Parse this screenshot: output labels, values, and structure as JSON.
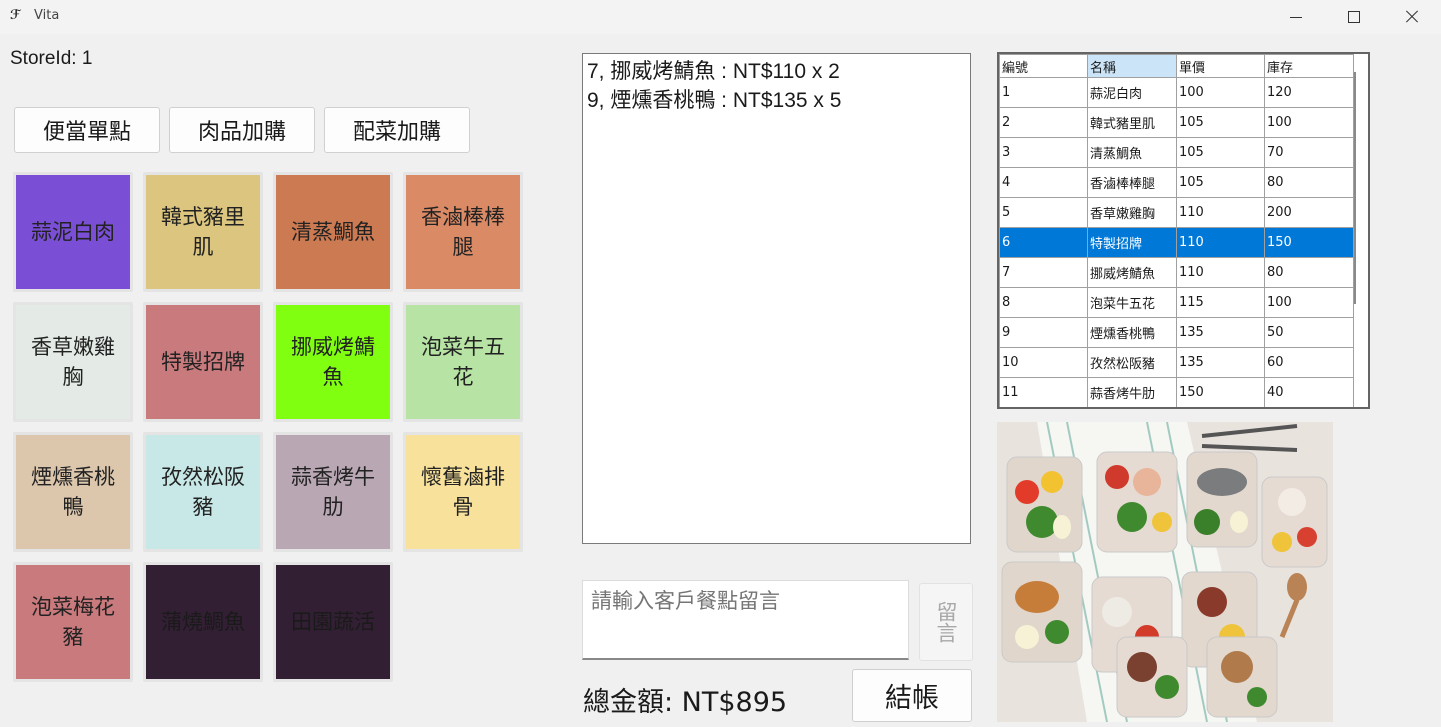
{
  "window": {
    "title": "Vita",
    "icon": "app-logo-icon"
  },
  "store": {
    "label": "StoreId: 1"
  },
  "categories": [
    {
      "label": "便當單點"
    },
    {
      "label": "肉品加購"
    },
    {
      "label": "配菜加購"
    }
  ],
  "menu_items": [
    {
      "name": "蒜泥白肉",
      "color": "#7a4fd6"
    },
    {
      "name": "韓式豬里肌",
      "color": "#dcc67f"
    },
    {
      "name": "清蒸鯛魚",
      "color": "#cc7a52"
    },
    {
      "name": "香滷棒棒腿",
      "color": "#db8a66"
    },
    {
      "name": "香草嫩雞胸",
      "color": "#e4ebe6"
    },
    {
      "name": "特製招牌",
      "color": "#c97a7d"
    },
    {
      "name": "挪威烤鯖魚",
      "color": "#80ff10"
    },
    {
      "name": "泡菜牛五花",
      "color": "#b7e3a4"
    },
    {
      "name": "煙燻香桃鴨",
      "color": "#dcc7ad"
    },
    {
      "name": "孜然松阪豬",
      "color": "#c7e8e7"
    },
    {
      "name": "蒜香烤牛肋",
      "color": "#b9a7b4"
    },
    {
      "name": "懷舊滷排骨",
      "color": "#f7e19b"
    },
    {
      "name": "泡菜梅花豬",
      "color": "#c97a7d"
    },
    {
      "name": "蒲燒鯛魚",
      "color": "#321f33"
    },
    {
      "name": "田園蔬活",
      "color": "#321f33"
    }
  ],
  "order": {
    "lines": [
      "7, 挪威烤鯖魚 : NT$110 x 2",
      "9, 煙燻香桃鴨 : NT$135 x 5"
    ]
  },
  "note": {
    "placeholder": "請輸入客戶餐點留言",
    "button_label": "留言"
  },
  "total": {
    "label": "總金額: NT$895"
  },
  "checkout": {
    "label": "結帳"
  },
  "inventory": {
    "headers": [
      "編號",
      "名稱",
      "單價",
      "庫存"
    ],
    "selected_row": 5,
    "rows": [
      [
        "1",
        "蒜泥白肉",
        "100",
        "120"
      ],
      [
        "2",
        "韓式豬里肌",
        "105",
        "100"
      ],
      [
        "3",
        "清蒸鯛魚",
        "105",
        "70"
      ],
      [
        "4",
        "香滷棒棒腿",
        "105",
        "80"
      ],
      [
        "5",
        "香草嫩雞胸",
        "110",
        "200"
      ],
      [
        "6",
        "特製招牌",
        "110",
        "150"
      ],
      [
        "7",
        "挪威烤鯖魚",
        "110",
        "80"
      ],
      [
        "8",
        "泡菜牛五花",
        "115",
        "100"
      ],
      [
        "9",
        "煙燻香桃鴨",
        "135",
        "50"
      ],
      [
        "10",
        "孜然松阪豬",
        "135",
        "60"
      ],
      [
        "11",
        "蒜香烤牛肋",
        "150",
        "40"
      ]
    ]
  },
  "colors": {
    "selection": "#0078d7",
    "header_highlight": "#cce4f7"
  }
}
